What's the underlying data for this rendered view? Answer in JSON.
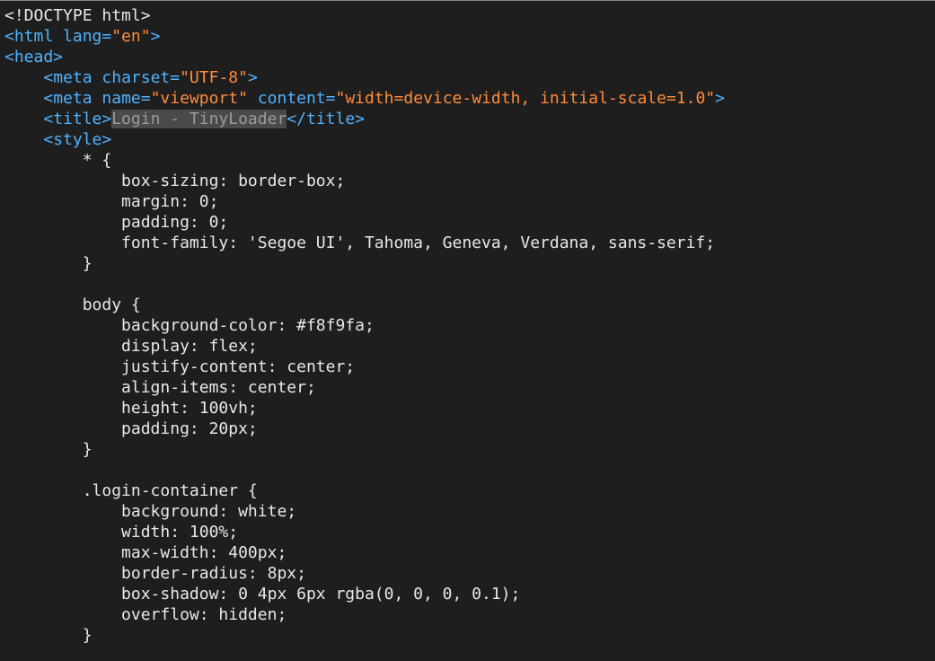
{
  "editor": {
    "lines": [
      {
        "i": "",
        "segs": [
          {
            "t": "plain",
            "v": "<!DOCTYPE html>"
          }
        ]
      },
      {
        "i": "",
        "segs": [
          {
            "t": "tag",
            "v": "<html "
          },
          {
            "t": "attr",
            "v": "lang="
          },
          {
            "t": "str",
            "v": "\"en\""
          },
          {
            "t": "tag",
            "v": ">"
          }
        ]
      },
      {
        "i": "",
        "segs": [
          {
            "t": "tag",
            "v": "<head>"
          }
        ]
      },
      {
        "i": "    ",
        "segs": [
          {
            "t": "tag",
            "v": "<meta "
          },
          {
            "t": "attr",
            "v": "charset="
          },
          {
            "t": "str",
            "v": "\"UTF-8\""
          },
          {
            "t": "tag",
            "v": ">"
          }
        ]
      },
      {
        "i": "    ",
        "segs": [
          {
            "t": "tag",
            "v": "<meta "
          },
          {
            "t": "attr",
            "v": "name="
          },
          {
            "t": "str",
            "v": "\"viewport\""
          },
          {
            "t": "attr",
            "v": " content="
          },
          {
            "t": "str",
            "v": "\"width=device-width, initial-scale=1.0\""
          },
          {
            "t": "tag",
            "v": ">"
          }
        ]
      },
      {
        "i": "    ",
        "segs": [
          {
            "t": "tag",
            "v": "<title>"
          },
          {
            "t": "sel",
            "v": "Login - TinyLoader"
          },
          {
            "t": "tag",
            "v": "</title>"
          }
        ]
      },
      {
        "i": "    ",
        "segs": [
          {
            "t": "tag",
            "v": "<style>"
          }
        ]
      },
      {
        "i": "        ",
        "segs": [
          {
            "t": "plain",
            "v": "* {"
          }
        ]
      },
      {
        "i": "            ",
        "segs": [
          {
            "t": "plain",
            "v": "box-sizing: border-box;"
          }
        ]
      },
      {
        "i": "            ",
        "segs": [
          {
            "t": "plain",
            "v": "margin: 0;"
          }
        ]
      },
      {
        "i": "            ",
        "segs": [
          {
            "t": "plain",
            "v": "padding: 0;"
          }
        ]
      },
      {
        "i": "            ",
        "segs": [
          {
            "t": "plain",
            "v": "font-family: 'Segoe UI', Tahoma, Geneva, Verdana, sans-serif;"
          }
        ]
      },
      {
        "i": "        ",
        "segs": [
          {
            "t": "plain",
            "v": "}"
          }
        ]
      },
      {
        "i": "",
        "segs": []
      },
      {
        "i": "        ",
        "segs": [
          {
            "t": "plain",
            "v": "body {"
          }
        ]
      },
      {
        "i": "            ",
        "segs": [
          {
            "t": "plain",
            "v": "background-color: #f8f9fa;"
          }
        ]
      },
      {
        "i": "            ",
        "segs": [
          {
            "t": "plain",
            "v": "display: flex;"
          }
        ]
      },
      {
        "i": "            ",
        "segs": [
          {
            "t": "plain",
            "v": "justify-content: center;"
          }
        ]
      },
      {
        "i": "            ",
        "segs": [
          {
            "t": "plain",
            "v": "align-items: center;"
          }
        ]
      },
      {
        "i": "            ",
        "segs": [
          {
            "t": "plain",
            "v": "height: 100vh;"
          }
        ]
      },
      {
        "i": "            ",
        "segs": [
          {
            "t": "plain",
            "v": "padding: 20px;"
          }
        ]
      },
      {
        "i": "        ",
        "segs": [
          {
            "t": "plain",
            "v": "}"
          }
        ]
      },
      {
        "i": "",
        "segs": []
      },
      {
        "i": "        ",
        "segs": [
          {
            "t": "plain",
            "v": ".login-container {"
          }
        ]
      },
      {
        "i": "            ",
        "segs": [
          {
            "t": "plain",
            "v": "background: white;"
          }
        ]
      },
      {
        "i": "            ",
        "segs": [
          {
            "t": "plain",
            "v": "width: 100%;"
          }
        ]
      },
      {
        "i": "            ",
        "segs": [
          {
            "t": "plain",
            "v": "max-width: 400px;"
          }
        ]
      },
      {
        "i": "            ",
        "segs": [
          {
            "t": "plain",
            "v": "border-radius: 8px;"
          }
        ]
      },
      {
        "i": "            ",
        "segs": [
          {
            "t": "plain",
            "v": "box-shadow: 0 4px 6px rgba(0, 0, 0, 0.1);"
          }
        ]
      },
      {
        "i": "            ",
        "segs": [
          {
            "t": "plain",
            "v": "overflow: hidden;"
          }
        ]
      },
      {
        "i": "        ",
        "segs": [
          {
            "t": "plain",
            "v": "}"
          }
        ]
      }
    ]
  },
  "colors": {
    "background": "#1e1e1e",
    "tag": "#4fb3ff",
    "string": "#ff8c3a",
    "text": "#e8e8e8",
    "selection": "#4a4a4a"
  }
}
